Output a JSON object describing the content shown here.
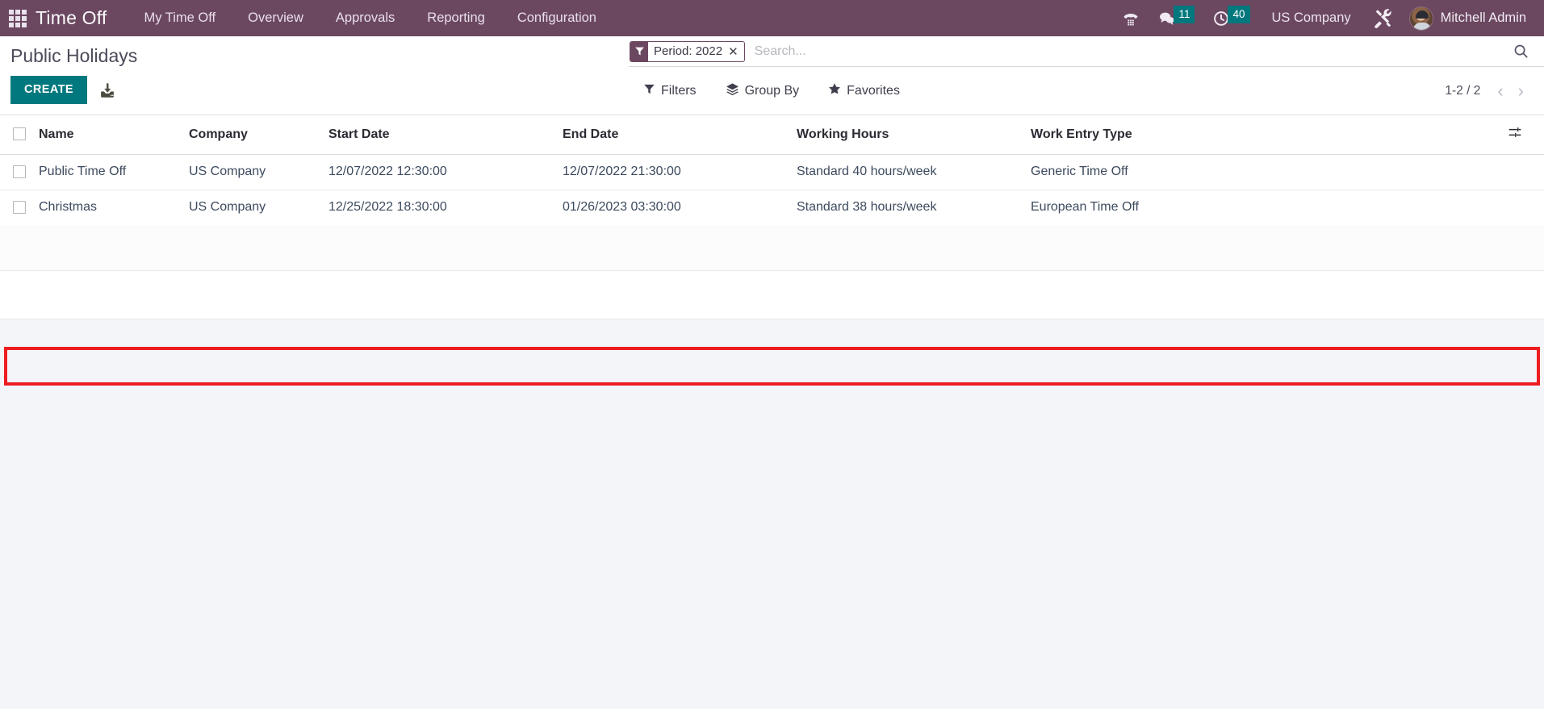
{
  "navbar": {
    "apps_icon": "apps-grid-icon",
    "brand": "Time Off",
    "menu": [
      {
        "label": "My Time Off",
        "name": "nav-my-time-off"
      },
      {
        "label": "Overview",
        "name": "nav-overview"
      },
      {
        "label": "Approvals",
        "name": "nav-approvals"
      },
      {
        "label": "Reporting",
        "name": "nav-reporting"
      },
      {
        "label": "Configuration",
        "name": "nav-configuration"
      }
    ],
    "phone_icon": "voip-phone-icon",
    "messages": {
      "icon": "chat-bubble-icon",
      "count": "11"
    },
    "activities": {
      "icon": "clock-icon",
      "count": "40"
    },
    "company": "US Company",
    "tools_icon": "tools-icon",
    "user": "Mitchell Admin",
    "bg_color": "#6b4860",
    "badge_color": "#00787d"
  },
  "control_panel": {
    "title": "Public Holidays",
    "create_label": "CREATE",
    "create_color": "#00787d",
    "export_icon": "export-download-icon",
    "search": {
      "facet_icon": "filter-funnel-icon",
      "facet_label": "Period: 2022",
      "facet_remove": "✕",
      "placeholder": "Search...",
      "value": "",
      "magnifier_icon": "search-icon"
    },
    "filters_label": "Filters",
    "filters_icon": "funnel-icon",
    "groupby_label": "Group By",
    "groupby_icon": "layers-icon",
    "favorites_label": "Favorites",
    "favorites_icon": "star-icon",
    "pager": {
      "range": "1-2 / 2",
      "prev_icon": "chevron-left-icon",
      "next_icon": "chevron-right-icon"
    }
  },
  "list": {
    "columns": [
      "Name",
      "Company",
      "Start Date",
      "End Date",
      "Working Hours",
      "Work Entry Type"
    ],
    "optional_columns_icon": "column-settings-icon",
    "rows": [
      {
        "name": "Public Time Off",
        "company": "US Company",
        "start_date": "12/07/2022 12:30:00",
        "end_date": "12/07/2022 21:30:00",
        "working_hours": "Standard 40 hours/week",
        "work_entry_type": "Generic Time Off",
        "highlighted": false
      },
      {
        "name": "Christmas",
        "company": "US Company",
        "start_date": "12/25/2022 18:30:00",
        "end_date": "01/26/2023 03:30:00",
        "working_hours": "Standard 38 hours/week",
        "work_entry_type": "European Time Off",
        "highlighted": true
      }
    ],
    "highlight_color": "#ee1d20"
  }
}
